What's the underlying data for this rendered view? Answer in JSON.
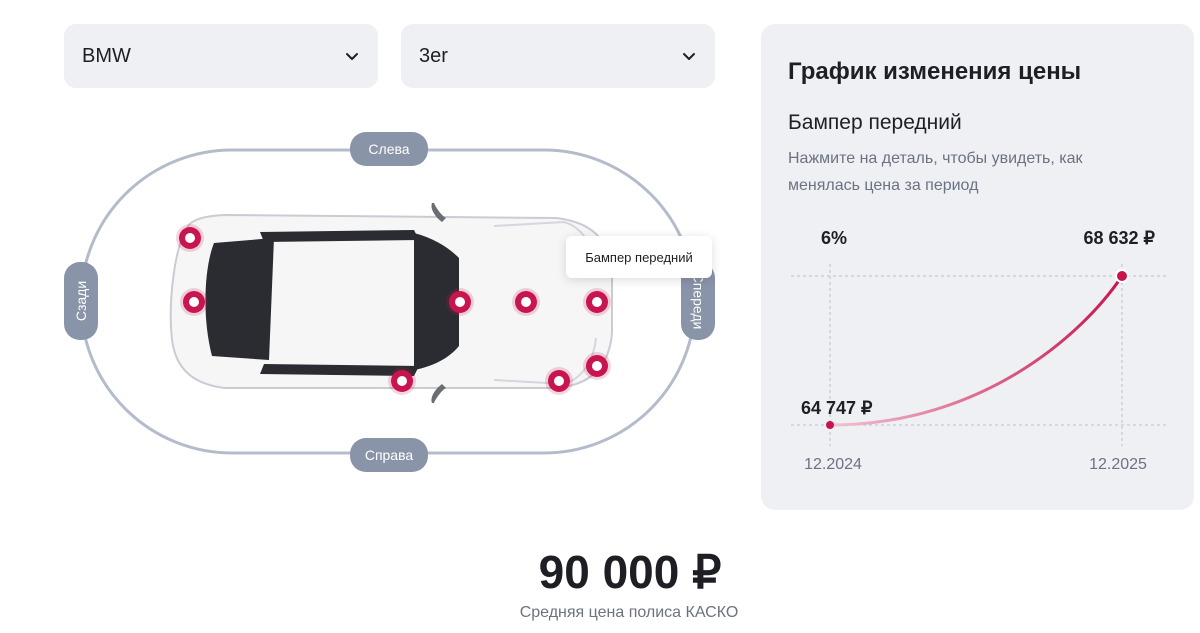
{
  "selects": {
    "brand": "BMW",
    "model": "3er"
  },
  "car": {
    "side_labels": {
      "left": "Слева",
      "right": "Справа",
      "back": "Сзади",
      "front": "Спереди"
    },
    "tooltip": "Бампер передний"
  },
  "panel": {
    "title": "График изменения цены",
    "part": "Бампер передний",
    "hint": "Нажмите на деталь, чтобы увидеть, как менялась цена за период"
  },
  "chart_data": {
    "type": "line",
    "x": [
      "12.2024",
      "12.2025"
    ],
    "values": [
      64747,
      68632
    ],
    "value_labels": [
      "64 747 ₽",
      "68 632 ₽"
    ],
    "change_label": "6%",
    "colors": {
      "line": "#c8154d",
      "grid": "#b9bfcc"
    }
  },
  "summary": {
    "price": "90 000 ₽",
    "caption": "Средняя цена полиса КАСКО"
  },
  "colors": {
    "accent": "#c8154d",
    "pill": "#8a94a8",
    "panel_bg": "#eef0f4"
  }
}
